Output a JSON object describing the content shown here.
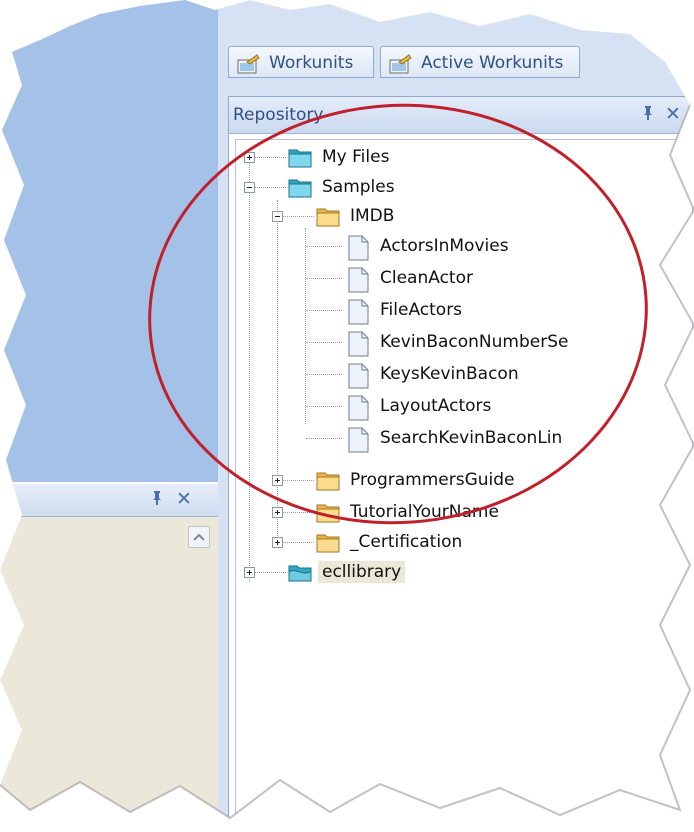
{
  "tabs": [
    {
      "label": "Workunits"
    },
    {
      "label": "Active Workunits"
    }
  ],
  "repository": {
    "title": "Repository",
    "pin_glyph": "ᵖ",
    "close_glyph": "✕"
  },
  "left_bottom_panel": {
    "pin_glyph": "ᵖ",
    "close_glyph": "✕"
  },
  "tree": {
    "my_files": "My Files",
    "samples": "Samples",
    "imdb": "IMDB",
    "files": [
      "ActorsInMovies",
      "CleanActor",
      "FileActors",
      "KevinBaconNumberSe",
      "KeysKevinBacon",
      "LayoutActors",
      "SearchKevinBaconLin"
    ],
    "programmers_guide": "ProgrammersGuide",
    "tutorial": "TutorialYourName",
    "certification": "_Certification",
    "ecllibrary": "ecllibrary"
  },
  "icons": {
    "folder_cyan": "folder-cyan-icon",
    "folder_yellow": "folder-yellow-icon",
    "file": "file-icon",
    "library": "library-icon",
    "workunits": "workunits-icon"
  },
  "colors": {
    "annotation": "#c0202a",
    "accent": "#2f4f86",
    "panel_bg": "#a4c1e8"
  }
}
